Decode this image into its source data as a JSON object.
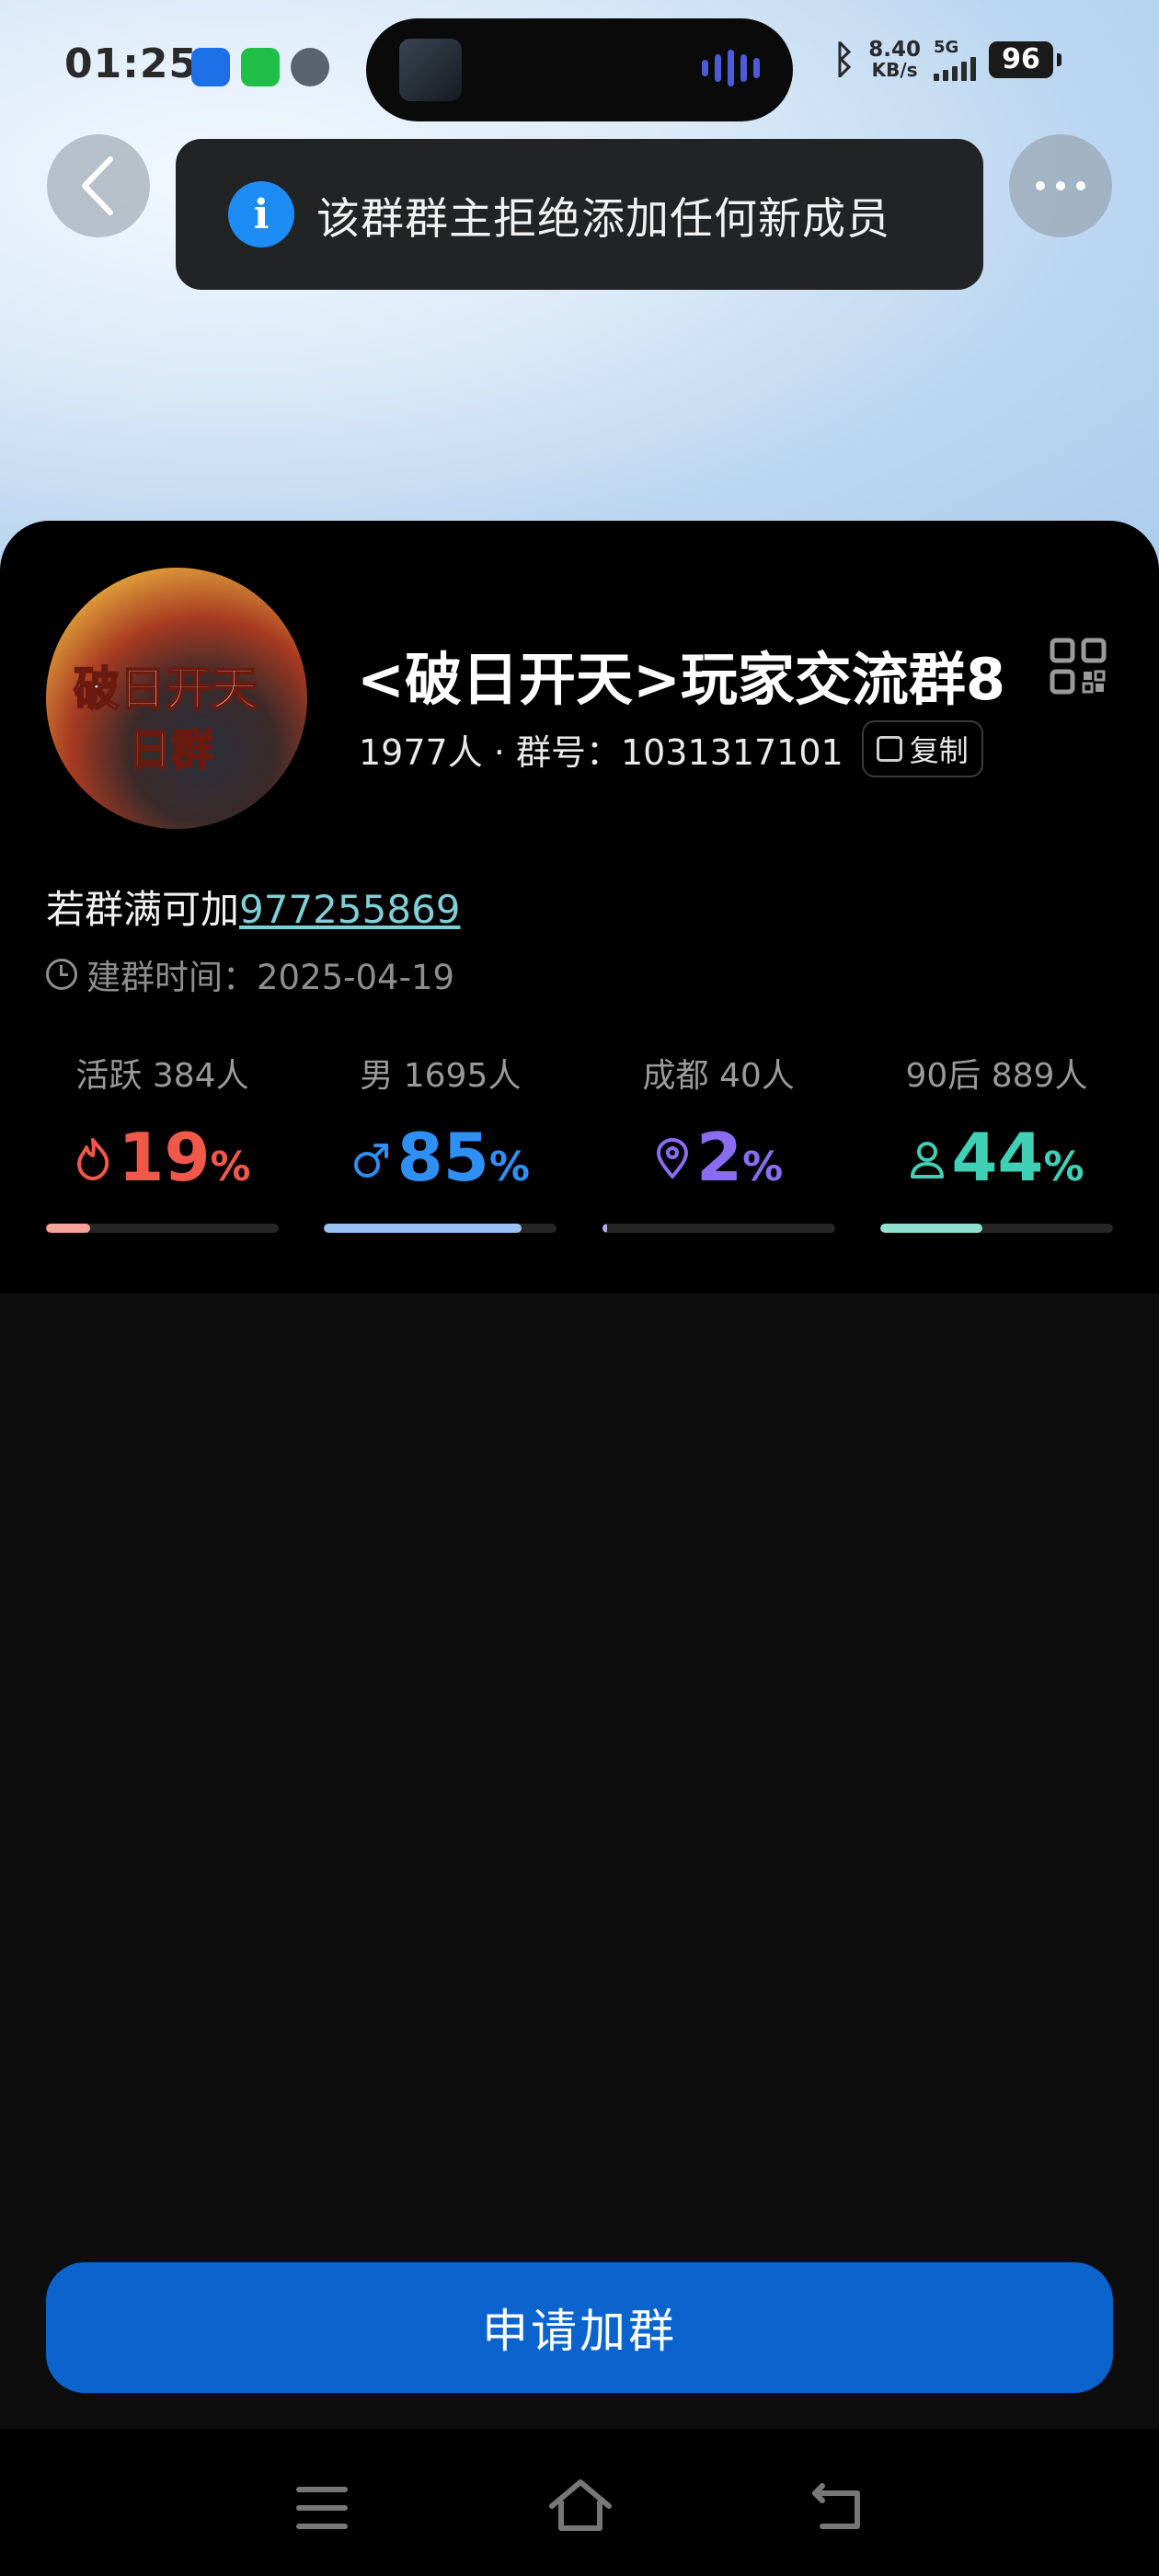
{
  "status_bar": {
    "time": "01:25",
    "net_speed": "8.40",
    "net_unit": "KB/s",
    "network": "5G",
    "battery": "96"
  },
  "toast": {
    "message": "该群群主拒绝添加任何新成员"
  },
  "group": {
    "name": "<破日开天>玩家交流群8",
    "members": "1977人 · 群号：1031317101",
    "copy_label": "复制",
    "avatar_text_1": "破日开天",
    "avatar_text_2": "日群",
    "desc_prefix": "若群满可加",
    "desc_link": "977255869",
    "created": "建群时间：2025-04-19"
  },
  "stats": [
    {
      "label": "活跃 384人",
      "value": "19",
      "unit": "%",
      "icon": "flame-icon",
      "color": "#f0584a",
      "fraction": 0.19
    },
    {
      "label": "男 1695人",
      "value": "85",
      "unit": "%",
      "icon": "male-icon",
      "color": "#2e8ff5",
      "fraction": 0.85
    },
    {
      "label": "成都 40人",
      "value": "2",
      "unit": "%",
      "icon": "location-icon",
      "color": "#8a6cf0",
      "fraction": 0.02
    },
    {
      "label": "90后 889人",
      "value": "44",
      "unit": "%",
      "icon": "person-icon",
      "color": "#3fd0b6",
      "fraction": 0.44
    }
  ],
  "bar_colors": [
    "#f6a39a",
    "#9ac2f5",
    "#b6a9f2",
    "#8fe0cf"
  ],
  "apply_button": "申请加群"
}
